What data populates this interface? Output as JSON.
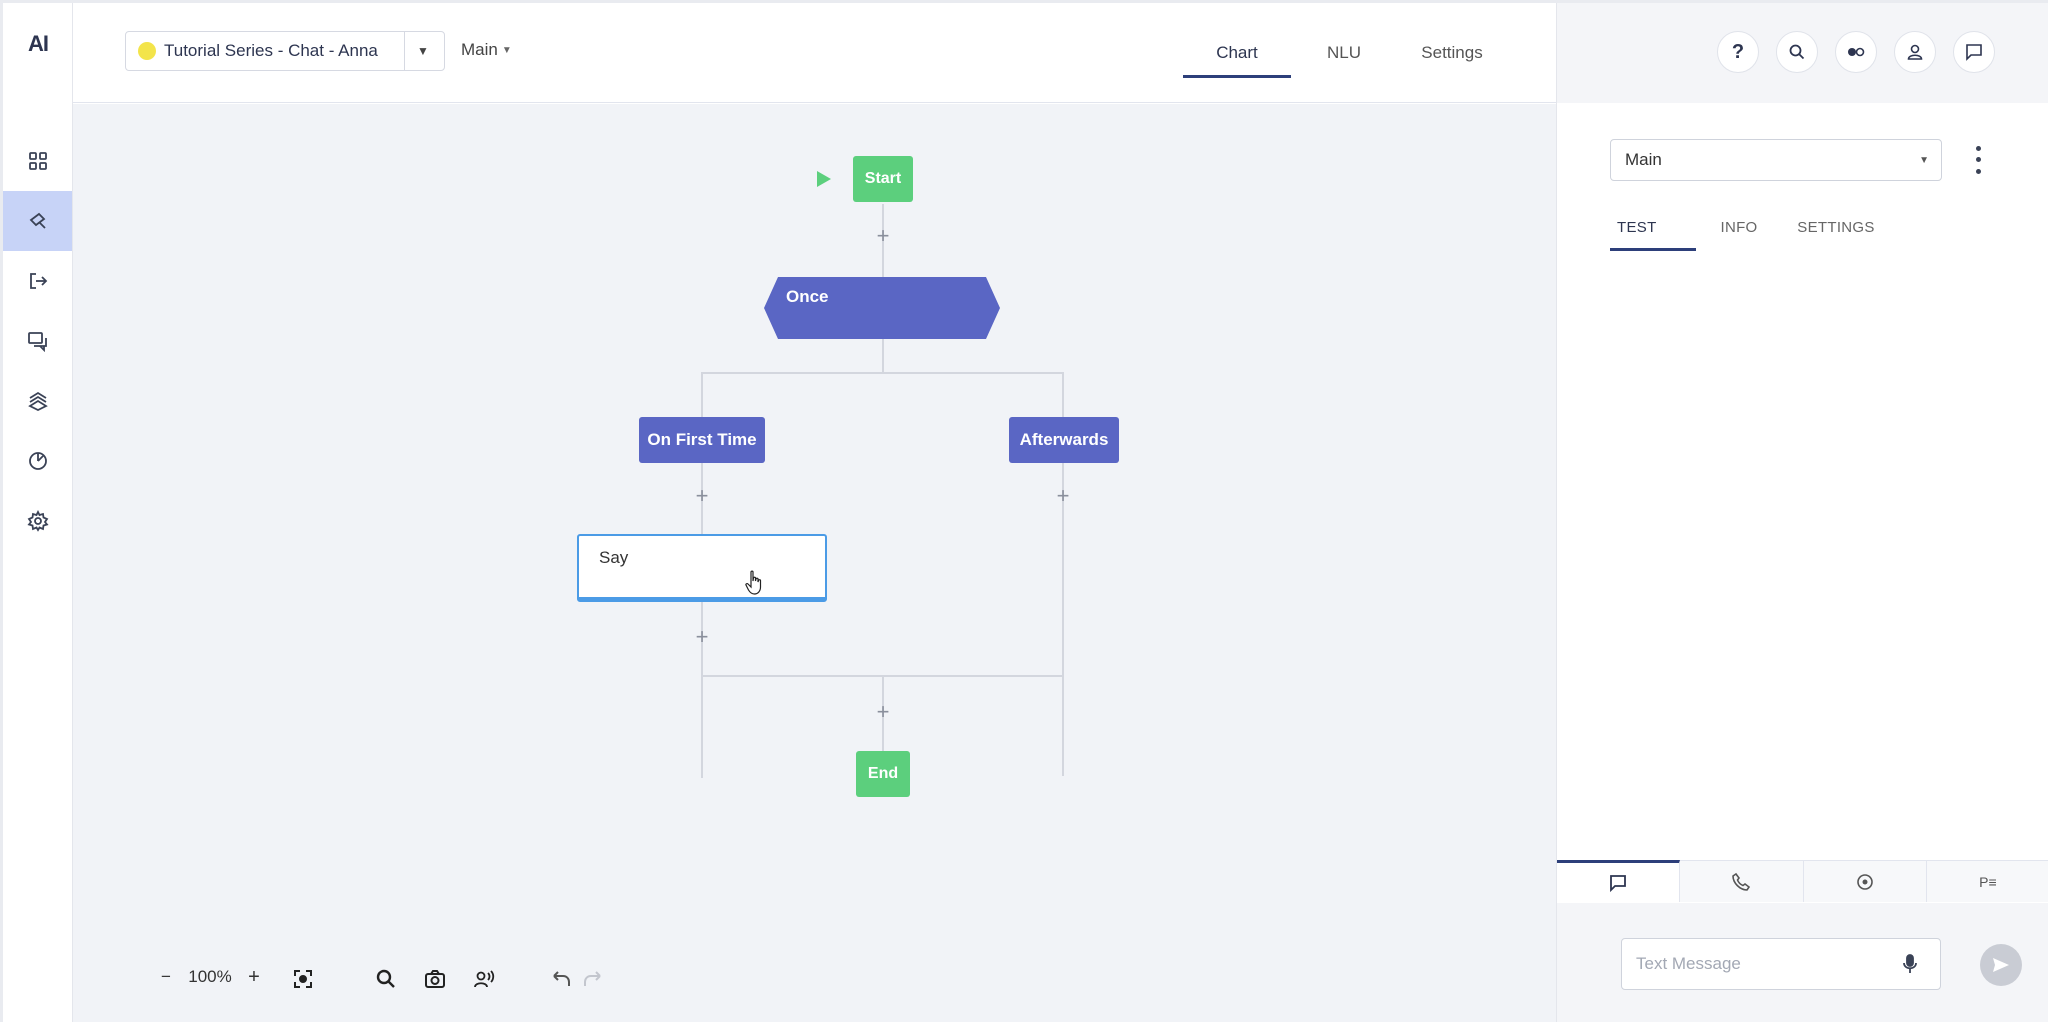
{
  "logo": "AI",
  "header": {
    "project_name": "Tutorial Series - Chat - Anna",
    "flow_name": "Main",
    "tabs": [
      {
        "label": "Chart",
        "active": true
      },
      {
        "label": "NLU",
        "active": false
      },
      {
        "label": "Settings",
        "active": false
      }
    ]
  },
  "sidebar": {
    "items": [
      {
        "icon": "grid-icon"
      },
      {
        "icon": "flow-editor-icon",
        "active": true
      },
      {
        "icon": "export-icon"
      },
      {
        "icon": "conversations-icon"
      },
      {
        "icon": "layers-icon"
      },
      {
        "icon": "analytics-icon"
      },
      {
        "icon": "gear-icon"
      }
    ]
  },
  "flow": {
    "start_label": "Start",
    "once_label": "Once",
    "first_time_label": "On First Time",
    "afterwards_label": "Afterwards",
    "say_label": "Say",
    "end_label": "End"
  },
  "toolbar": {
    "zoom_out": "−",
    "zoom_level": "100%",
    "zoom_in": "+"
  },
  "panel": {
    "flow_select": "Main",
    "tabs": [
      {
        "label": "TEST",
        "active": true
      },
      {
        "label": "INFO",
        "active": false
      },
      {
        "label": "SETTINGS",
        "active": false
      }
    ],
    "channels": [
      "chat-icon",
      "phone-icon",
      "record-icon",
      "P≡"
    ],
    "message_placeholder": "Text Message"
  },
  "colors": {
    "accent": "#2d3f7a",
    "node_green": "#5ccf7d",
    "node_blue": "#5a66c4",
    "selected_border": "#4b9be6",
    "rail_active": "#c7d3f7"
  }
}
